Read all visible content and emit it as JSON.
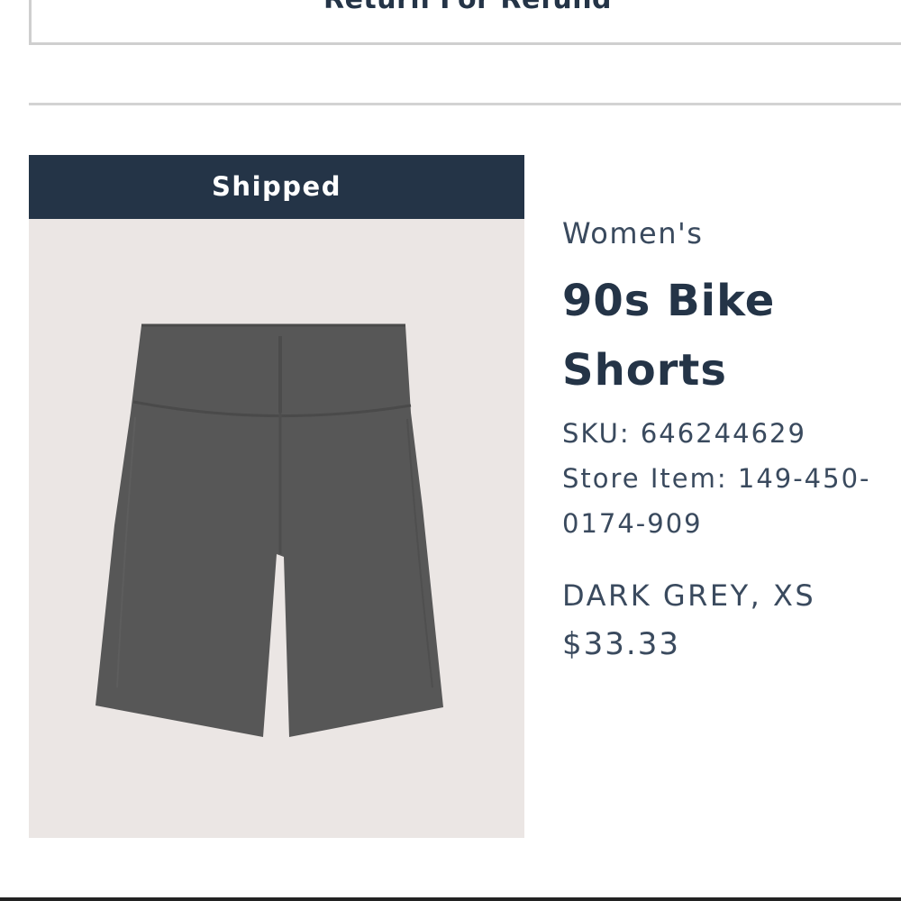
{
  "return_button": {
    "label": "Return For Refund"
  },
  "order_item": {
    "status": "Shipped",
    "image_alt": "Dark grey high-rise bike shorts",
    "category": "Women's",
    "name": "90s Bike Shorts",
    "sku": "SKU: 646244629",
    "store_item": "Store Item: 149-450-0174-909",
    "variant": "DARK GREY, XS",
    "price": "$33.33"
  },
  "colors": {
    "navy": "#243447",
    "image_background": "#ebe6e4",
    "shorts": "#555555",
    "divider": "#d3d3d3"
  }
}
